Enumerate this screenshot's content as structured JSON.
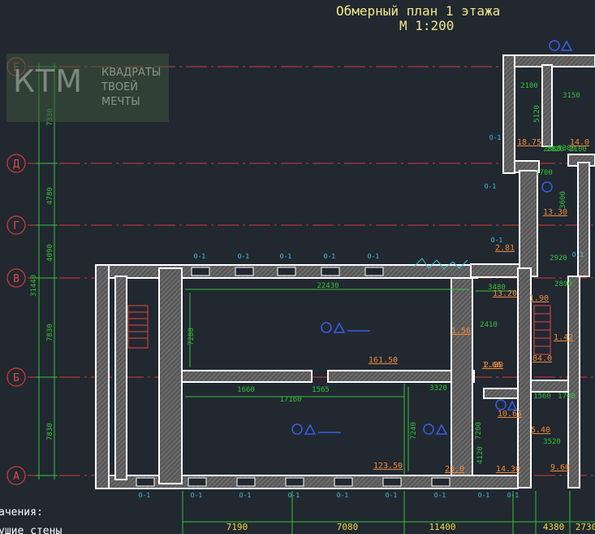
{
  "title": {
    "line1": "Обмерный план 1 этажа",
    "line2": "М 1:200"
  },
  "logo": {
    "mark": "КТМ",
    "line1": "КВАДРАТЫ",
    "line2": "ТВОЕЙ",
    "line3": "МЕЧТЫ"
  },
  "axes": [
    "Е",
    "Д",
    "Г",
    "В",
    "Б",
    "А"
  ],
  "dims_vertical": {
    "left": [
      "7330",
      "4780",
      "4090",
      "7830",
      "7830"
    ],
    "total": "31440"
  },
  "dims_horizontal_bottom": [
    "7190",
    "7080",
    "11400",
    "4380",
    "2730"
  ],
  "dims_plan": [
    "22430",
    "17160",
    "1660",
    "1565",
    "3320",
    "3480",
    "2410",
    "2100",
    "3150",
    "1700",
    "1300",
    "3600",
    "2920",
    "2890",
    "5120",
    "2880",
    "7200",
    "7240",
    "7200",
    "4120",
    "1560",
    "1700",
    "3520",
    "2820",
    "2100"
  ],
  "areas": [
    "18.75",
    "14.0",
    "13.30",
    "2.81",
    "13.20",
    "1.56",
    "161.50",
    "1.66",
    "123.50",
    "23.0",
    "1.90",
    "1.42",
    "84.0",
    "10.65",
    "5.40",
    "14.30",
    "9.60",
    "2.80"
  ],
  "window_marks": [
    "О-1",
    "О-1",
    "О-1",
    "О-1",
    "О-1",
    "О-1",
    "О-1",
    "О-1",
    "О-1",
    "О-1",
    "О-1",
    "О-1",
    "О-1",
    "О-1",
    "О-1",
    "О-1",
    "О-1",
    "О-1"
  ],
  "legend": {
    "label1": "ачения:",
    "label2": "ушие стены"
  }
}
